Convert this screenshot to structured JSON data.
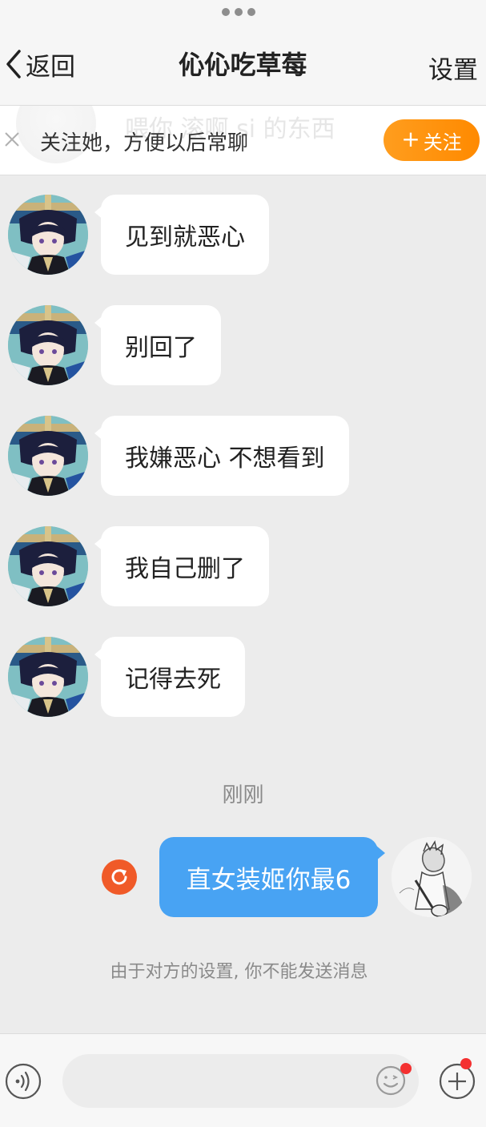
{
  "header": {
    "back_label": "返回",
    "title": "伈伈吃草莓",
    "settings_label": "设置"
  },
  "follow_bar": {
    "background_text": "喂你 滚啊 si 的东西",
    "prompt": "关注她，方便以后常聊",
    "button_label": "关注",
    "button_color": "#ff9500"
  },
  "messages": [
    {
      "sender": "other",
      "text": "见到就恶心"
    },
    {
      "sender": "other",
      "text": "别回了"
    },
    {
      "sender": "other",
      "text": "我嫌恶心 不想看到"
    },
    {
      "sender": "other",
      "text": "我自己删了"
    },
    {
      "sender": "other",
      "text": "记得去死"
    }
  ],
  "timestamp": "刚刚",
  "outgoing": {
    "text": "直女装姬你最6",
    "status": "failed",
    "bubble_color": "#48a3f3",
    "retry_color": "#f05a28"
  },
  "notice": "由于对方的设置, 你不能发送消息",
  "input_bar": {
    "voice_icon": "voice-icon",
    "emoji_icon": "emoji-icon",
    "plus_icon": "plus-icon",
    "badge_color": "#f43030"
  }
}
